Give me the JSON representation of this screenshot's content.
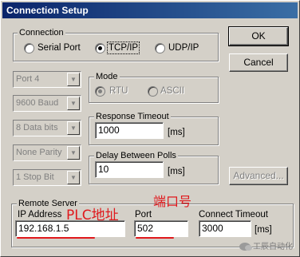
{
  "window": {
    "title": "Connection Setup"
  },
  "buttons": {
    "ok": "OK",
    "cancel": "Cancel",
    "advanced": "Advanced..."
  },
  "connection": {
    "label": "Connection",
    "options": [
      {
        "label": "Serial Port",
        "selected": false
      },
      {
        "label": "TCP/IP",
        "selected": true
      },
      {
        "label": "UDP/IP",
        "selected": false
      }
    ]
  },
  "serial": {
    "port": "Port 4",
    "baud": "9600 Baud",
    "data_bits": "8 Data bits",
    "parity": "None Parity",
    "stop_bits": "1 Stop Bit"
  },
  "mode": {
    "label": "Mode",
    "options": [
      {
        "label": "RTU",
        "selected": true
      },
      {
        "label": "ASCII",
        "selected": false
      }
    ]
  },
  "response_timeout": {
    "label": "Response Timeout",
    "value": "1000",
    "unit": "[ms]"
  },
  "delay_between_polls": {
    "label": "Delay Between Polls",
    "value": "10",
    "unit": "[ms]"
  },
  "remote_server": {
    "label": "Remote Server",
    "ip_label": "IP Address",
    "ip_value": "192.168.1.5",
    "port_label": "Port",
    "port_value": "502",
    "timeout_label": "Connect Timeout",
    "timeout_value": "3000",
    "timeout_unit": "[ms]"
  },
  "annotations": {
    "plc_address": "PLC地址",
    "port_number": "端口号",
    "accent_color": "#e0181c"
  },
  "watermark": {
    "text": "工辰自动化",
    "icon": "wechat-icon"
  }
}
